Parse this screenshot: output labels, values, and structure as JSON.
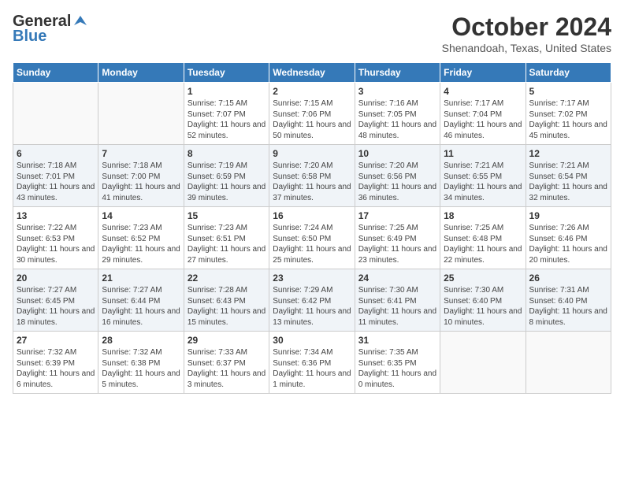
{
  "header": {
    "logo_general": "General",
    "logo_blue": "Blue",
    "title": "October 2024",
    "location": "Shenandoah, Texas, United States"
  },
  "days_of_week": [
    "Sunday",
    "Monday",
    "Tuesday",
    "Wednesday",
    "Thursday",
    "Friday",
    "Saturday"
  ],
  "weeks": [
    [
      {
        "day": "",
        "detail": ""
      },
      {
        "day": "",
        "detail": ""
      },
      {
        "day": "1",
        "detail": "Sunrise: 7:15 AM\nSunset: 7:07 PM\nDaylight: 11 hours and 52 minutes."
      },
      {
        "day": "2",
        "detail": "Sunrise: 7:15 AM\nSunset: 7:06 PM\nDaylight: 11 hours and 50 minutes."
      },
      {
        "day": "3",
        "detail": "Sunrise: 7:16 AM\nSunset: 7:05 PM\nDaylight: 11 hours and 48 minutes."
      },
      {
        "day": "4",
        "detail": "Sunrise: 7:17 AM\nSunset: 7:04 PM\nDaylight: 11 hours and 46 minutes."
      },
      {
        "day": "5",
        "detail": "Sunrise: 7:17 AM\nSunset: 7:02 PM\nDaylight: 11 hours and 45 minutes."
      }
    ],
    [
      {
        "day": "6",
        "detail": "Sunrise: 7:18 AM\nSunset: 7:01 PM\nDaylight: 11 hours and 43 minutes."
      },
      {
        "day": "7",
        "detail": "Sunrise: 7:18 AM\nSunset: 7:00 PM\nDaylight: 11 hours and 41 minutes."
      },
      {
        "day": "8",
        "detail": "Sunrise: 7:19 AM\nSunset: 6:59 PM\nDaylight: 11 hours and 39 minutes."
      },
      {
        "day": "9",
        "detail": "Sunrise: 7:20 AM\nSunset: 6:58 PM\nDaylight: 11 hours and 37 minutes."
      },
      {
        "day": "10",
        "detail": "Sunrise: 7:20 AM\nSunset: 6:56 PM\nDaylight: 11 hours and 36 minutes."
      },
      {
        "day": "11",
        "detail": "Sunrise: 7:21 AM\nSunset: 6:55 PM\nDaylight: 11 hours and 34 minutes."
      },
      {
        "day": "12",
        "detail": "Sunrise: 7:21 AM\nSunset: 6:54 PM\nDaylight: 11 hours and 32 minutes."
      }
    ],
    [
      {
        "day": "13",
        "detail": "Sunrise: 7:22 AM\nSunset: 6:53 PM\nDaylight: 11 hours and 30 minutes."
      },
      {
        "day": "14",
        "detail": "Sunrise: 7:23 AM\nSunset: 6:52 PM\nDaylight: 11 hours and 29 minutes."
      },
      {
        "day": "15",
        "detail": "Sunrise: 7:23 AM\nSunset: 6:51 PM\nDaylight: 11 hours and 27 minutes."
      },
      {
        "day": "16",
        "detail": "Sunrise: 7:24 AM\nSunset: 6:50 PM\nDaylight: 11 hours and 25 minutes."
      },
      {
        "day": "17",
        "detail": "Sunrise: 7:25 AM\nSunset: 6:49 PM\nDaylight: 11 hours and 23 minutes."
      },
      {
        "day": "18",
        "detail": "Sunrise: 7:25 AM\nSunset: 6:48 PM\nDaylight: 11 hours and 22 minutes."
      },
      {
        "day": "19",
        "detail": "Sunrise: 7:26 AM\nSunset: 6:46 PM\nDaylight: 11 hours and 20 minutes."
      }
    ],
    [
      {
        "day": "20",
        "detail": "Sunrise: 7:27 AM\nSunset: 6:45 PM\nDaylight: 11 hours and 18 minutes."
      },
      {
        "day": "21",
        "detail": "Sunrise: 7:27 AM\nSunset: 6:44 PM\nDaylight: 11 hours and 16 minutes."
      },
      {
        "day": "22",
        "detail": "Sunrise: 7:28 AM\nSunset: 6:43 PM\nDaylight: 11 hours and 15 minutes."
      },
      {
        "day": "23",
        "detail": "Sunrise: 7:29 AM\nSunset: 6:42 PM\nDaylight: 11 hours and 13 minutes."
      },
      {
        "day": "24",
        "detail": "Sunrise: 7:30 AM\nSunset: 6:41 PM\nDaylight: 11 hours and 11 minutes."
      },
      {
        "day": "25",
        "detail": "Sunrise: 7:30 AM\nSunset: 6:40 PM\nDaylight: 11 hours and 10 minutes."
      },
      {
        "day": "26",
        "detail": "Sunrise: 7:31 AM\nSunset: 6:40 PM\nDaylight: 11 hours and 8 minutes."
      }
    ],
    [
      {
        "day": "27",
        "detail": "Sunrise: 7:32 AM\nSunset: 6:39 PM\nDaylight: 11 hours and 6 minutes."
      },
      {
        "day": "28",
        "detail": "Sunrise: 7:32 AM\nSunset: 6:38 PM\nDaylight: 11 hours and 5 minutes."
      },
      {
        "day": "29",
        "detail": "Sunrise: 7:33 AM\nSunset: 6:37 PM\nDaylight: 11 hours and 3 minutes."
      },
      {
        "day": "30",
        "detail": "Sunrise: 7:34 AM\nSunset: 6:36 PM\nDaylight: 11 hours and 1 minute."
      },
      {
        "day": "31",
        "detail": "Sunrise: 7:35 AM\nSunset: 6:35 PM\nDaylight: 11 hours and 0 minutes."
      },
      {
        "day": "",
        "detail": ""
      },
      {
        "day": "",
        "detail": ""
      }
    ]
  ]
}
